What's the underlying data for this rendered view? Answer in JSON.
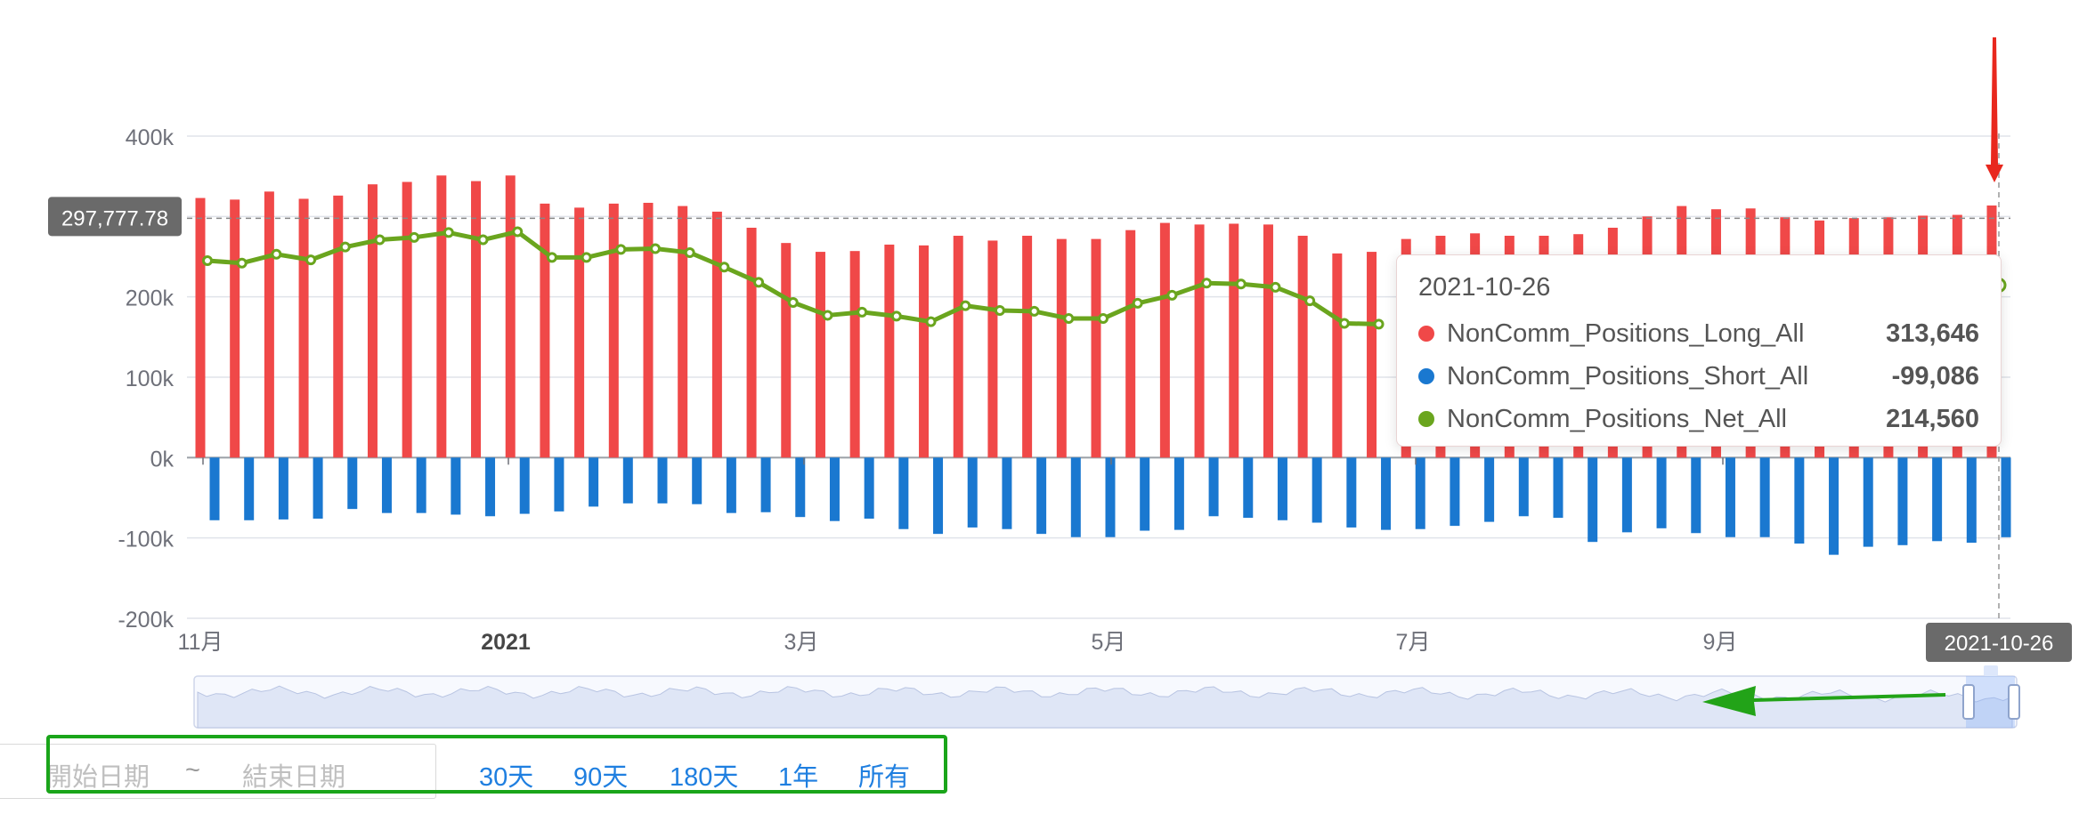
{
  "chart_data": {
    "type": "bar",
    "x": [
      "2020-10-27",
      "2020-11-03",
      "2020-11-10",
      "2020-11-17",
      "2020-11-24",
      "2020-12-01",
      "2020-12-08",
      "2020-12-15",
      "2020-12-22",
      "2020-12-29",
      "2021-01-05",
      "2021-01-12",
      "2021-01-19",
      "2021-01-26",
      "2021-02-02",
      "2021-02-09",
      "2021-02-16",
      "2021-02-23",
      "2021-03-02",
      "2021-03-09",
      "2021-03-16",
      "2021-03-23",
      "2021-03-30",
      "2021-04-06",
      "2021-04-13",
      "2021-04-20",
      "2021-04-27",
      "2021-05-04",
      "2021-05-11",
      "2021-05-18",
      "2021-05-25",
      "2021-06-01",
      "2021-06-08",
      "2021-06-15",
      "2021-06-22",
      "2021-06-29",
      "2021-07-06",
      "2021-07-13",
      "2021-07-20",
      "2021-07-27",
      "2021-08-03",
      "2021-08-10",
      "2021-08-17",
      "2021-08-24",
      "2021-08-31",
      "2021-09-07",
      "2021-09-14",
      "2021-09-21",
      "2021-09-28",
      "2021-10-05",
      "2021-10-12",
      "2021-10-19",
      "2021-10-26"
    ],
    "series": [
      {
        "name": "NonComm_Positions_Long_All",
        "type": "bar",
        "color": "#f04848",
        "values": [
          323000,
          321000,
          331000,
          322000,
          326000,
          340000,
          343000,
          351000,
          344000,
          351000,
          316000,
          311000,
          316000,
          317000,
          313000,
          306000,
          286000,
          267000,
          256000,
          257000,
          265000,
          264000,
          276000,
          270000,
          276000,
          272000,
          272000,
          283000,
          292000,
          290000,
          291000,
          290000,
          276000,
          254000,
          256000,
          272000,
          276000,
          279000,
          276000,
          276000,
          278000,
          286000,
          300000,
          313000,
          309000,
          310000,
          299000,
          295000,
          298000,
          299000,
          301000,
          302000,
          313646
        ]
      },
      {
        "name": "NonComm_Positions_Short_All",
        "type": "bar",
        "color": "#1a78d0",
        "values": [
          -78000,
          -78000,
          -77000,
          -76000,
          -64000,
          -69000,
          -69000,
          -71000,
          -73000,
          -70000,
          -67000,
          -61000,
          -57000,
          -57000,
          -58000,
          -69000,
          -68000,
          -74000,
          -79000,
          -76000,
          -89000,
          -95000,
          -87000,
          -89000,
          -95000,
          -99000,
          -99000,
          -91000,
          -90000,
          -73000,
          -75000,
          -78000,
          -81000,
          -87000,
          -90000,
          -89000,
          -85000,
          -80000,
          -73000,
          -75000,
          -105000,
          -93000,
          -88000,
          -94000,
          -99000,
          -99000,
          -107000,
          -121000,
          -111000,
          -109000,
          -104000,
          -106000,
          -99086
        ]
      },
      {
        "name": "NonComm_Positions_Net_All",
        "type": "line",
        "color": "#6aa51e",
        "values": [
          245000,
          242000,
          253000,
          246000,
          262000,
          271000,
          274000,
          280000,
          271000,
          281000,
          249000,
          249000,
          259000,
          260000,
          255000,
          237000,
          218000,
          193000,
          177000,
          181000,
          176000,
          169000,
          189000,
          183000,
          182000,
          173000,
          173000,
          192000,
          202000,
          217000,
          216000,
          212000,
          195000,
          167000,
          166000,
          null,
          null,
          null,
          null,
          null,
          null,
          null,
          null,
          null,
          null,
          null,
          null,
          null,
          null,
          null,
          null,
          195000,
          214560
        ]
      }
    ],
    "x_tick_labels": [
      "11月",
      "2021",
      "3月",
      "5月",
      "7月",
      "9月"
    ],
    "y_tick_labels": [
      "400k",
      "200k",
      "100k",
      "0k",
      "-100k",
      "-200k"
    ],
    "ylim": [
      -200000,
      400000
    ],
    "crosshair_y_label": "297,777.78",
    "crosshair_x_label": "2021-10-26",
    "legend": "none",
    "grid": true
  },
  "tooltip": {
    "date": "2021-10-26",
    "items": [
      {
        "name": "NonComm_Positions_Long_All",
        "value": "313,646",
        "color": "#f04848"
      },
      {
        "name": "NonComm_Positions_Short_All",
        "value": "-99,086",
        "color": "#1a78d0"
      },
      {
        "name": "NonComm_Positions_Net_All",
        "value": "214,560",
        "color": "#6aa51e"
      }
    ]
  },
  "controls": {
    "start_placeholder": "開始日期",
    "separator": "~",
    "end_placeholder": "結束日期",
    "quick_ranges": [
      "30天",
      "90天",
      "180天",
      "1年",
      "所有"
    ]
  }
}
